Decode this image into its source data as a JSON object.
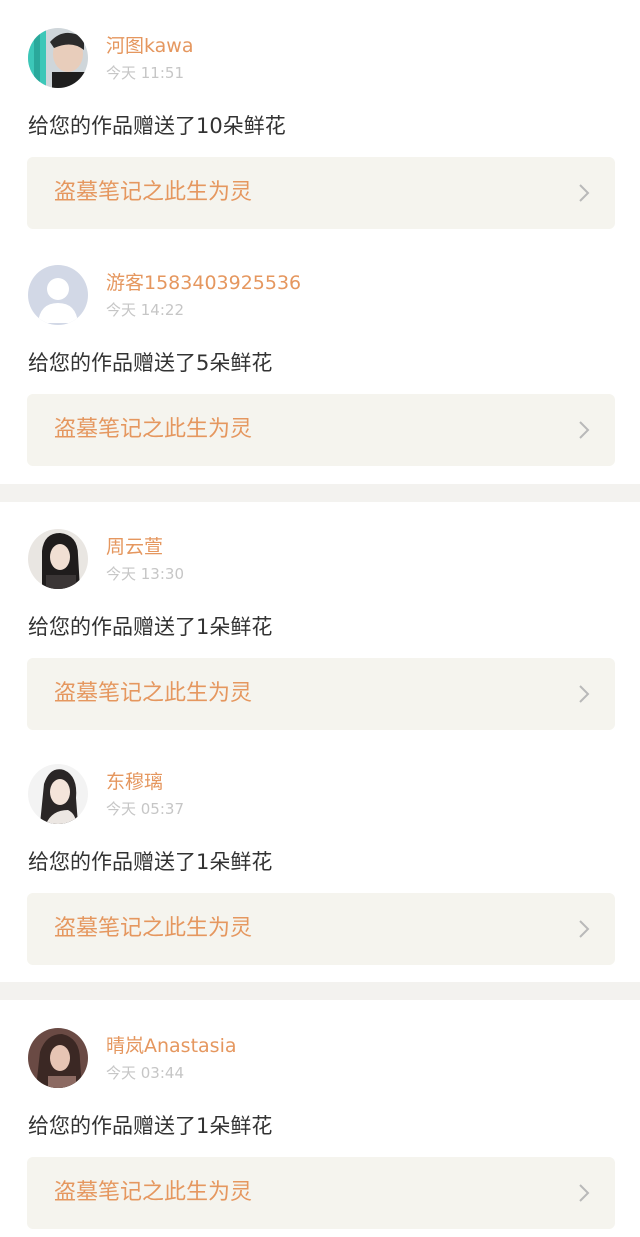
{
  "items": [
    {
      "name": "河图kawa",
      "time": "今天 11:51",
      "message": "给您的作品赠送了10朵鲜花",
      "work_title": "盗墓笔记之此生为灵",
      "avatar": "photo-avatar"
    },
    {
      "name": "游客1583403925536",
      "time": "今天 14:22",
      "message": "给您的作品赠送了5朵鲜花",
      "work_title": "盗墓笔记之此生为灵",
      "avatar": "default-user-avatar"
    },
    {
      "name": "周云萱",
      "time": "今天 13:30",
      "message": "给您的作品赠送了1朵鲜花",
      "work_title": "盗墓笔记之此生为灵",
      "avatar": "photo-avatar"
    },
    {
      "name": "东穆璃",
      "time": "今天 05:37",
      "message": "给您的作品赠送了1朵鲜花",
      "work_title": "盗墓笔记之此生为灵",
      "avatar": "photo-avatar"
    },
    {
      "name": "晴岚Anastasia",
      "time": "今天 03:44",
      "message": "给您的作品赠送了1朵鲜花",
      "work_title": "盗墓笔记之此生为灵",
      "avatar": "photo-avatar"
    }
  ],
  "colors": {
    "accent": "#e5975f",
    "card_bg": "#f5f4ee",
    "separator": "#f3f2ef",
    "text": "#333333",
    "muted": "#c6c6c6"
  },
  "icons": [
    "chevron-right-icon",
    "default-user-avatar"
  ]
}
